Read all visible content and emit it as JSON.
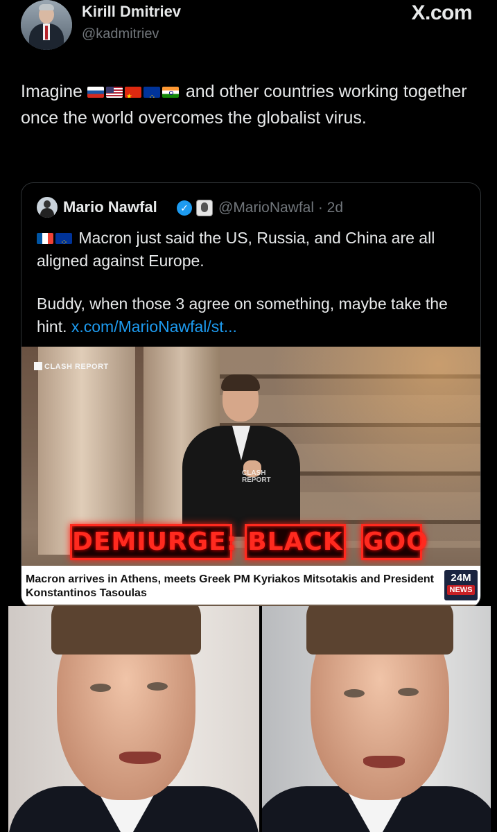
{
  "author": {
    "name": "Kirill Dmitriev",
    "handle": "@kadmitriev",
    "site_label": "X.com"
  },
  "tweet": {
    "text_before_flags": "Imagine ",
    "flags": [
      "flag-russia-icon",
      "flag-usa-icon",
      "flag-china-icon",
      "flag-eu-icon",
      "flag-india-icon"
    ],
    "text_after_flags": " and other countries working together once the world overcomes the globalist virus."
  },
  "quoted": {
    "name": "Mario Nawfal",
    "handle_time": "@MarioNawfal · 2d",
    "flags": [
      "flag-france-icon",
      "flag-eu-icon"
    ],
    "line1": " Macron just said the US, Russia, and China are all aligned against Europe.",
    "line2": "Buddy, when those 3 agree on something, maybe take the hint. ",
    "link": "x.com/MarioNawfal/st..."
  },
  "video": {
    "watermark": "CLASH REPORT",
    "watermark_top": "CLASH",
    "watermark_bottom": "REPORT",
    "overlay_words": [
      "DEMIURGE:",
      "BLACK",
      "GOO"
    ],
    "caption": "Macron arrives in Athens, meets Greek PM Kyriakos Mitsotakis and President Konstantinos Tasoulas",
    "news_logo_top": "24M",
    "news_logo_bottom": "NEWS"
  },
  "colors": {
    "background": "#000000",
    "link": "#1d9bf0",
    "verified": "#1d9bf0",
    "overlay_red": "#ff2a1f"
  }
}
